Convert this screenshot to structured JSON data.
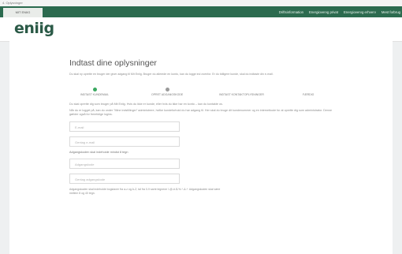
{
  "browser": {
    "url_text": "4. Oplysninger"
  },
  "topnav": {
    "home_tab": "MIT ENIIG",
    "links": [
      "Driftsinformation",
      "Energiovervg privat",
      "Energiovervg erhverv",
      "Mest forbrug"
    ]
  },
  "header": {
    "logo": "eniig"
  },
  "form": {
    "title": "Indtast dine oplysninger",
    "intro": "Du skal ny oprette en bruger der giver adgang til Mit Eniig. Bruger du allerede en konto, kan du logge ind ovenfor. Er du tidligere kunde, skal du indtaste din e-mail.",
    "steps": [
      {
        "label": "INDTAST KUNDEMAIL"
      },
      {
        "label": "OPRET ADGANGSKODE"
      },
      {
        "label": "INDTAST KONTAKTOPLYSNINGER"
      },
      {
        "label": "FÆRDIG"
      }
    ],
    "desc_1": "Du skal oprette dig som bruger på Mit Eniig. Hvis du ikke er kunde, eller hvis du ikke har en konto – kan du kontakte os.",
    "desc_2": "Når du er logget på, kan du under \"Mine indstillinger\" administrere, hvilke kundeforhold du har adgang til. Her skal du bruge dit kundenummer og en internetkode for at oprette dig som administrator. Denne gælder også for fremtidige logins.",
    "email_placeholder": "E-mail",
    "repeat_email_placeholder": "Gentag e-mail",
    "password_hint": "Adgangskoden skal indeholde mindst 8 tegn",
    "password_placeholder": "Adgangskode",
    "repeat_password_placeholder": "Gentag adgangskode",
    "fine_print": "Adgangskoden skal indeholde bogstaver fra a-z og A-Z, tal fra 0-9 samt tegnene !-@-#-$-%-^-&-*. Adgangskoden skal være mellem 8 og 40 tegn."
  }
}
